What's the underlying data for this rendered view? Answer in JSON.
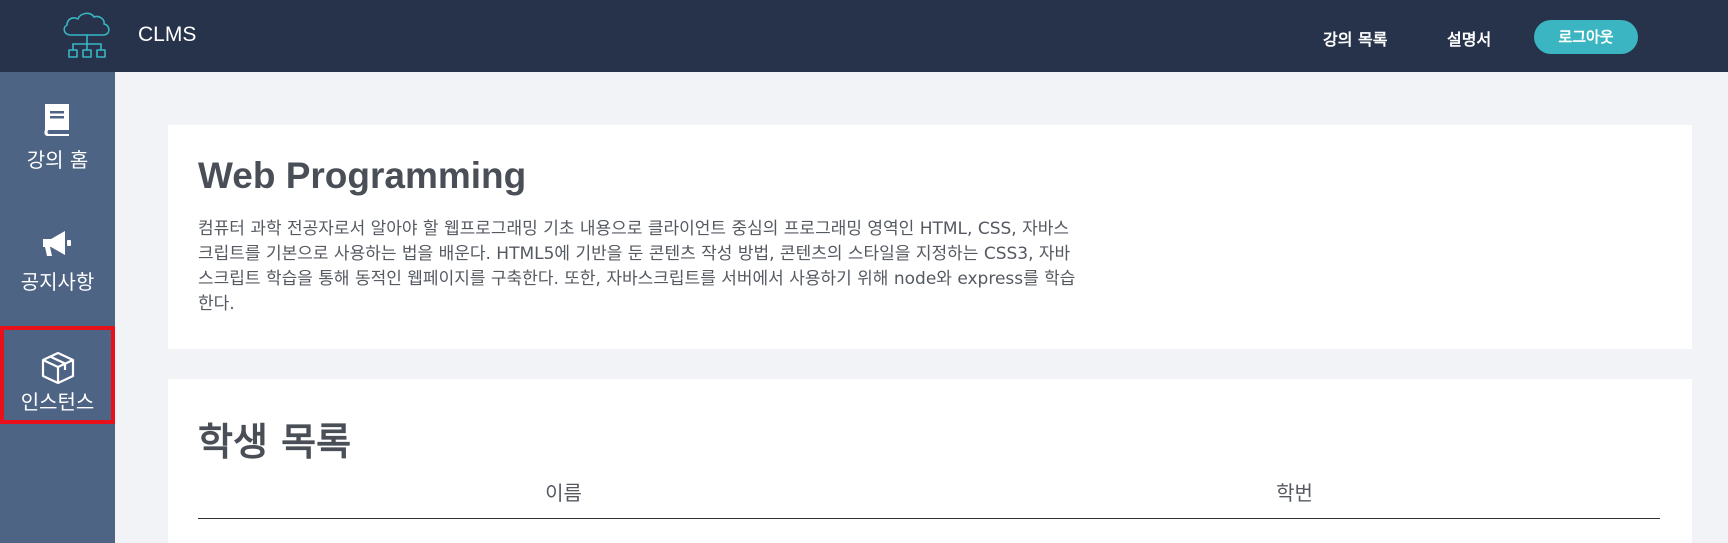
{
  "header": {
    "app_title": "CLMS",
    "nav": {
      "courses": "강의 목록",
      "manual": "설명서"
    },
    "logout_label": "로그아웃",
    "logo_icon": "cloud-network-icon"
  },
  "sidebar": {
    "items": [
      {
        "label": "강의 홈",
        "icon": "book-icon"
      },
      {
        "label": "공지사항",
        "icon": "megaphone-icon"
      },
      {
        "label": "인스턴스",
        "icon": "cube-icon",
        "highlighted": true
      }
    ]
  },
  "course": {
    "title": "Web Programming",
    "description": "컴퓨터 과학 전공자로서 알아야 할 웹프로그래밍 기초 내용으로 클라이언트 중심의 프로그래밍 영역인 HTML, CSS, 자바스크립트를 기본으로 사용하는 법을 배운다. HTML5에 기반을 둔 콘텐츠 작성 방법, 콘텐츠의 스타일을 지정하는 CSS3, 자바스크립트 학습을 통해 동적인 웹페이지를 구축한다. 또한, 자바스크립트를 서버에서 사용하기 위해 node와 express를 학습한다."
  },
  "students": {
    "title": "학생 목록",
    "columns": [
      "이름",
      "학번"
    ]
  },
  "colors": {
    "header_bg": "#26334a",
    "sidebar_bg": "#4e6484",
    "accent": "#3ab5c1",
    "highlight_border": "#e8111b",
    "page_bg": "#f2f3f7"
  }
}
